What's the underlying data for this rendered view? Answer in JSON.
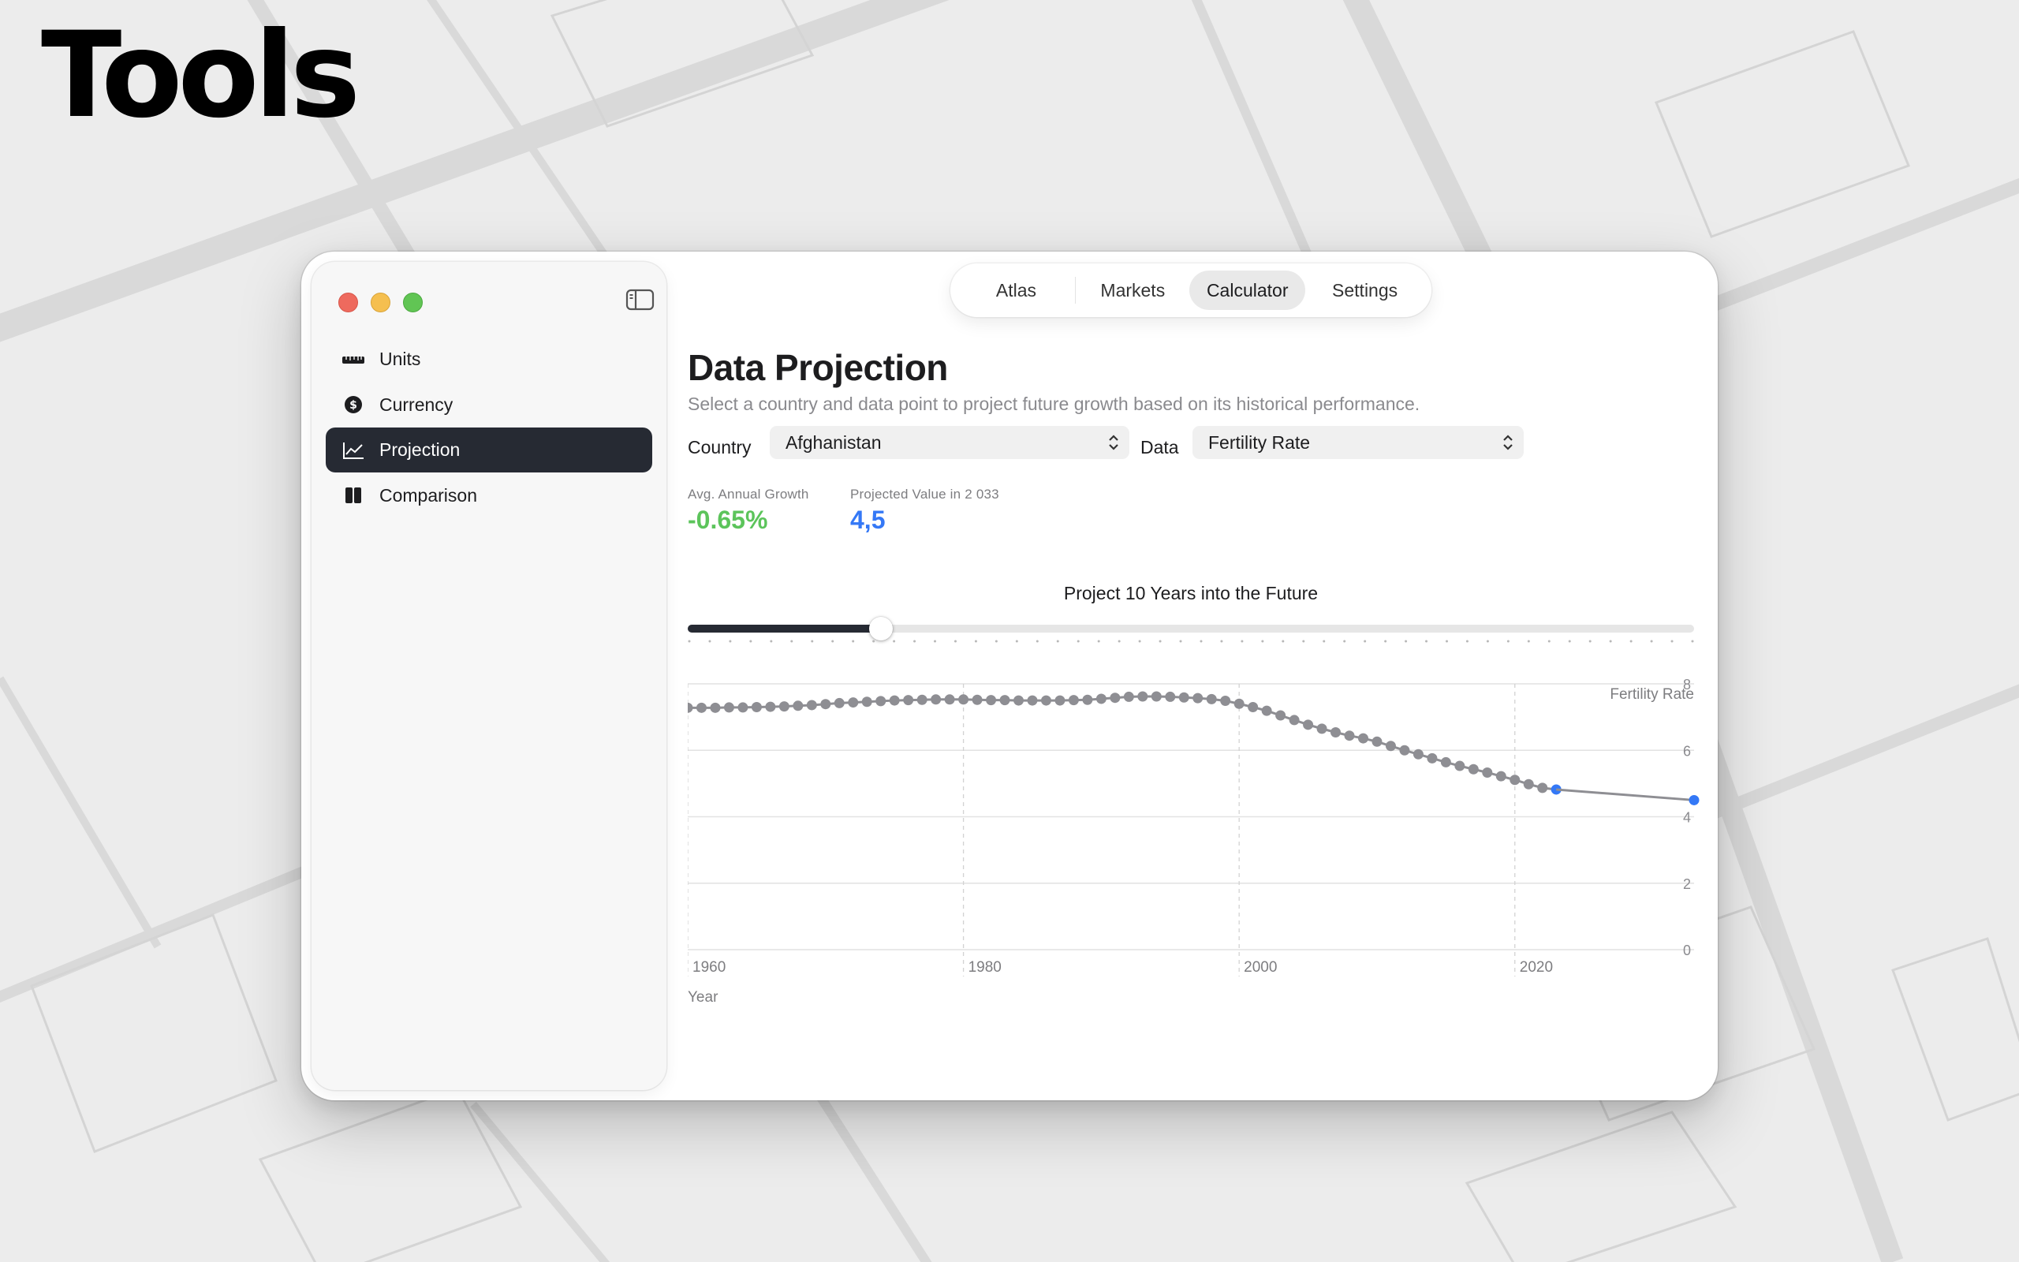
{
  "hero": {
    "title": "Tools"
  },
  "sidebar": {
    "items": [
      {
        "label": "Units",
        "icon": "ruler-icon",
        "active": false
      },
      {
        "label": "Currency",
        "icon": "dollar-circle-icon",
        "active": false
      },
      {
        "label": "Projection",
        "icon": "line-chart-icon",
        "active": true
      },
      {
        "label": "Comparison",
        "icon": "split-columns-icon",
        "active": false
      }
    ]
  },
  "tabs": [
    {
      "label": "Atlas",
      "active": false
    },
    {
      "label": "Markets",
      "active": false
    },
    {
      "label": "Calculator",
      "active": true
    },
    {
      "label": "Settings",
      "active": false
    }
  ],
  "page": {
    "title": "Data Projection",
    "subtitle": "Select a country and data point to project future growth based on its historical performance."
  },
  "controls": {
    "country_label": "Country",
    "country_value": "Afghanistan",
    "data_label": "Data",
    "data_value": "Fertility Rate"
  },
  "stats": {
    "growth_label": "Avg. Annual Growth",
    "growth_value": "-0.65%",
    "projected_label": "Projected Value in 2 033",
    "projected_value": "4,5"
  },
  "slider": {
    "title": "Project 10 Years into the Future",
    "value": 10,
    "min": 1,
    "max": 50
  },
  "colors": {
    "accent_dark": "#262a33",
    "growth_green": "#5cc45b",
    "projected_blue": "#3478f6",
    "series_gray": "#8e8e93"
  },
  "chart_data": {
    "type": "line",
    "xlabel": "Year",
    "ylabel": "Fertility Rate",
    "xlim": [
      1960,
      2033
    ],
    "ylim": [
      0,
      8
    ],
    "xticks": [
      1960,
      1980,
      2000,
      2020
    ],
    "yticks": [
      0,
      2,
      4,
      6,
      8
    ],
    "grid": true,
    "series": [
      {
        "x": [
          1960,
          1961,
          1962,
          1963,
          1964,
          1965,
          1966,
          1967,
          1968,
          1969,
          1970,
          1971,
          1972,
          1973,
          1974,
          1975,
          1976,
          1977,
          1978,
          1979,
          1980,
          1981,
          1982,
          1983,
          1984,
          1985,
          1986,
          1987,
          1988,
          1989,
          1990,
          1991,
          1992,
          1993,
          1994,
          1995,
          1996,
          1997,
          1998,
          1999,
          2000,
          2001,
          2002,
          2003,
          2004,
          2005,
          2006,
          2007,
          2008,
          2009,
          2010,
          2011,
          2012,
          2013,
          2014,
          2015,
          2016,
          2017,
          2018,
          2019,
          2020,
          2021,
          2022,
          2023
        ],
        "y": [
          7.28,
          7.28,
          7.28,
          7.29,
          7.29,
          7.3,
          7.31,
          7.32,
          7.34,
          7.36,
          7.39,
          7.42,
          7.44,
          7.46,
          7.48,
          7.5,
          7.51,
          7.52,
          7.53,
          7.53,
          7.53,
          7.52,
          7.51,
          7.51,
          7.5,
          7.5,
          7.5,
          7.5,
          7.51,
          7.52,
          7.55,
          7.58,
          7.61,
          7.62,
          7.62,
          7.61,
          7.59,
          7.57,
          7.54,
          7.49,
          7.4,
          7.3,
          7.19,
          7.05,
          6.91,
          6.77,
          6.65,
          6.54,
          6.44,
          6.36,
          6.26,
          6.13,
          6.0,
          5.88,
          5.76,
          5.64,
          5.53,
          5.43,
          5.33,
          5.22,
          5.11,
          4.98,
          4.87,
          4.82
        ]
      },
      {
        "x": [
          2023,
          2033
        ],
        "y": [
          4.82,
          4.5
        ]
      }
    ]
  }
}
